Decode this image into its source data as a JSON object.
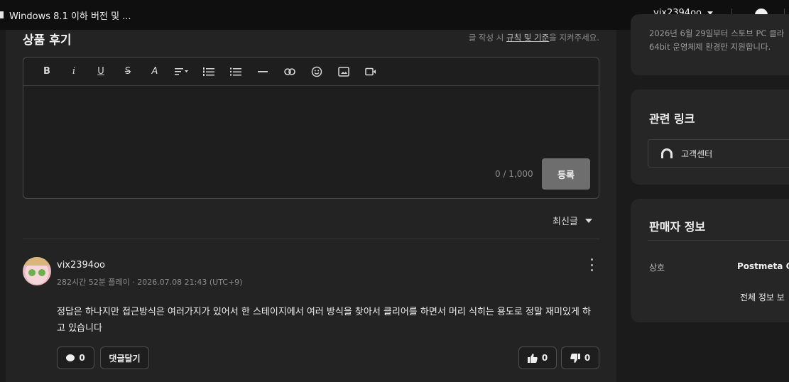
{
  "topbar": {
    "tab_title": "Windows 8.1 이하 버전 및 ...",
    "username": "vix2394oo"
  },
  "review_section": {
    "title": "상품 후기",
    "rules_prefix": "글 작성 시 ",
    "rules_link": "규칙 및 기준",
    "rules_suffix": "을 지켜주세요.",
    "counter": "0 / 1,000",
    "submit_label": "등록",
    "sort_label": "최신글"
  },
  "toolbar": {
    "bold": "B",
    "italic": "i",
    "underline": "U",
    "strike": "S",
    "font_color": "A"
  },
  "review": {
    "author": "vix2394oo",
    "meta": "282시간 52분 플레이 · 2026.07.08 21:43 (UTC+9)",
    "body": "정답은 하나지만 접근방식은 여러가지가 있어서 한 스테이지에서 여러 방식을 찾아서 클리어를 하면서 머리 식히는 용도로 정말 재미있게 하고 있습니다",
    "comment_count": "0",
    "reply_label": "댓글달기",
    "like_count": "0",
    "dislike_count": "0"
  },
  "sidebar": {
    "notice_line1": "2026년 6월 29일부터 스토브 PC 클라",
    "notice_line2": "64bit 운영체제 환경만 지원합니다.",
    "links_title": "관련 링크",
    "support_label": "고객센터",
    "seller_title": "판매자 정보",
    "seller_key": "상호",
    "seller_value": "Postmeta Ga",
    "seller_more": "전체 정보 보"
  }
}
